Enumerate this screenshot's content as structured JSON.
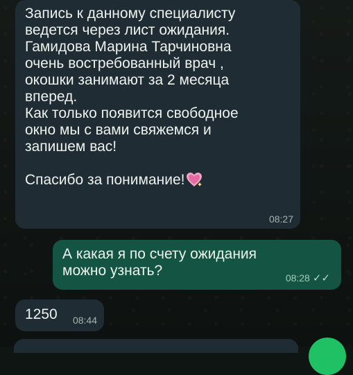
{
  "chat": {
    "messages": [
      {
        "direction": "incoming",
        "text": "Запись к данному специалисту\nведется через лист ожидания.\nГамидова Марина Тарчиновна\nочень востребованный врач ,\nокошки занимают за 2 месяца\nвперед.\nКак только появится свободное\nокно мы с вами свяжемся и\nзапишем вас!\n\nСпасибо за понимание!",
        "emoji_icon": "sparkling-heart",
        "time": "08:27"
      },
      {
        "direction": "outgoing",
        "text": "А какая я по счету ожидания\nможно узнать?",
        "time": "08:28",
        "status_icon": "double-check",
        "status_glyph": "✓✓"
      },
      {
        "direction": "incoming",
        "text": "1250",
        "time": "08:44"
      }
    ]
  },
  "colors": {
    "incoming_bubble": "#1f2c33",
    "outgoing_bubble": "#135542",
    "accent_fab": "#20c064"
  }
}
